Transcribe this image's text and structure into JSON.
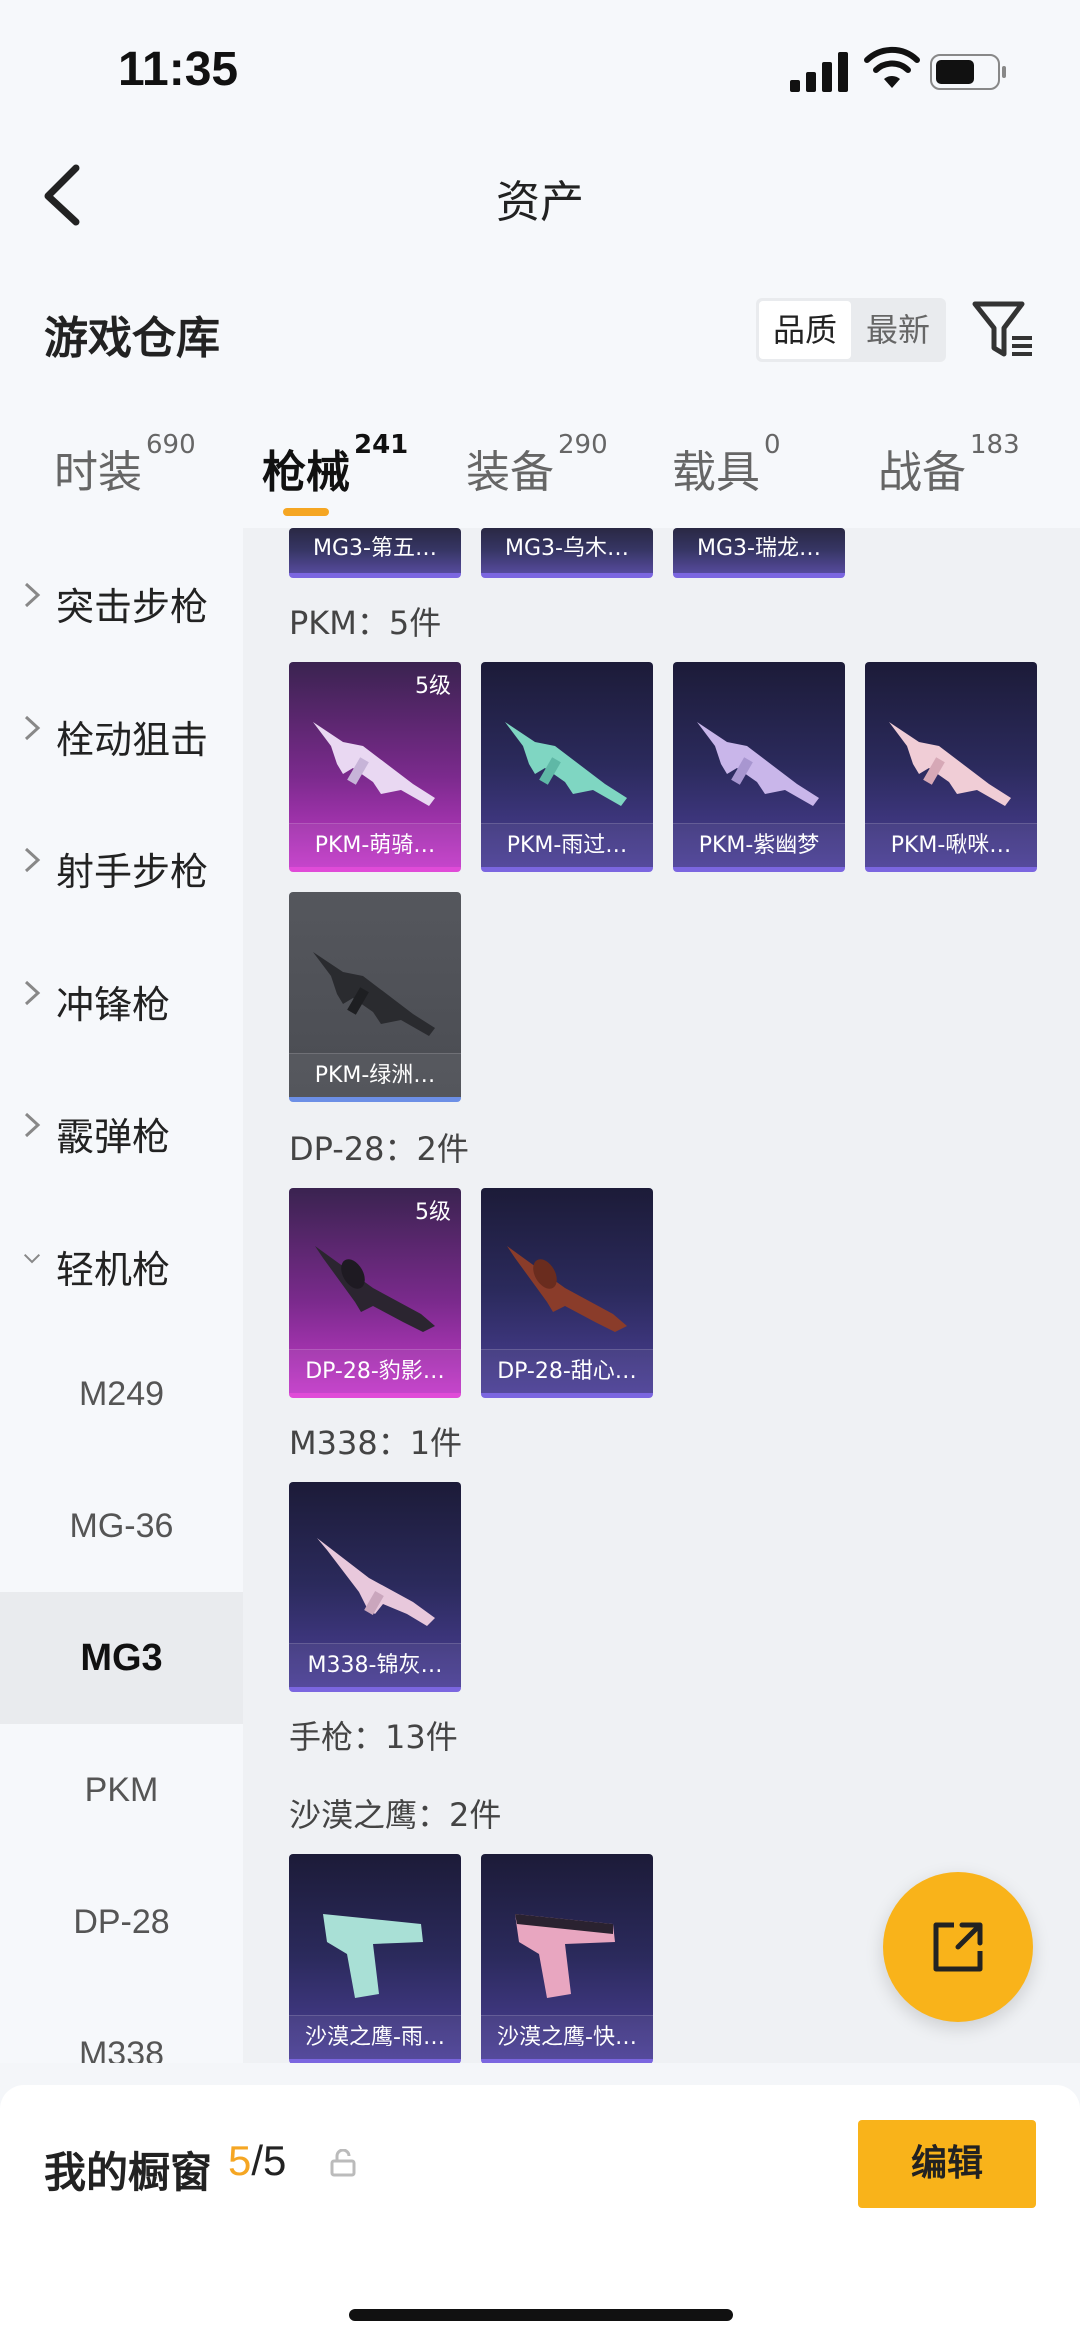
{
  "status_bar": {
    "time": "11:35"
  },
  "nav": {
    "title": "资产"
  },
  "warehouse": {
    "title": "游戏仓库",
    "sort_options": [
      "品质",
      "最新"
    ]
  },
  "tabs": [
    {
      "label": "时装",
      "count": "690"
    },
    {
      "label": "枪械",
      "count": "241"
    },
    {
      "label": "装备",
      "count": "290"
    },
    {
      "label": "载具",
      "count": "0"
    },
    {
      "label": "战备",
      "count": "183"
    }
  ],
  "sidebar": {
    "categories": [
      "突击步枪",
      "栓动狙击",
      "射手步枪",
      "冲锋枪",
      "霰弹枪",
      "轻机枪"
    ],
    "subcategories": [
      "M249",
      "MG-36",
      "MG3",
      "PKM",
      "DP-28",
      "M338"
    ],
    "active_sub": "MG3"
  },
  "content": {
    "top_cards": [
      "MG3-第五…",
      "MG3-乌木…",
      "MG3-瑞龙…"
    ],
    "sections": [
      {
        "title": "PKM：5件",
        "cards": [
          {
            "name": "PKM-萌骑…",
            "level": "5级",
            "rarity": "pink"
          },
          {
            "name": "PKM-雨过…",
            "rarity": "purple"
          },
          {
            "name": "PKM-紫幽梦",
            "rarity": "purple"
          },
          {
            "name": "PKM-啾咪…",
            "rarity": "purple"
          },
          {
            "name": "PKM-绿洲…",
            "rarity": "gray"
          }
        ]
      },
      {
        "title": "DP-28：2件",
        "cards": [
          {
            "name": "DP-28-豹影…",
            "level": "5级",
            "rarity": "pink"
          },
          {
            "name": "DP-28-甜心…",
            "rarity": "purple"
          }
        ]
      },
      {
        "title": "M338：1件",
        "cards": [
          {
            "name": "M338-锦灰…",
            "rarity": "purple"
          }
        ]
      },
      {
        "title": "手枪：13件",
        "cards": []
      },
      {
        "title": "沙漠之鹰：2件",
        "cards": [
          {
            "name": "沙漠之鹰-雨…",
            "rarity": "purple"
          },
          {
            "name": "沙漠之鹰-快…",
            "rarity": "purple"
          }
        ]
      }
    ]
  },
  "bottom": {
    "label": "我的橱窗",
    "count_current": "5",
    "count_total": "/5",
    "edit_label": "编辑"
  },
  "colors": {
    "accent": "#f9b31a",
    "pink_rarity": "#e04bd8",
    "purple_rarity": "#7b66e0"
  }
}
